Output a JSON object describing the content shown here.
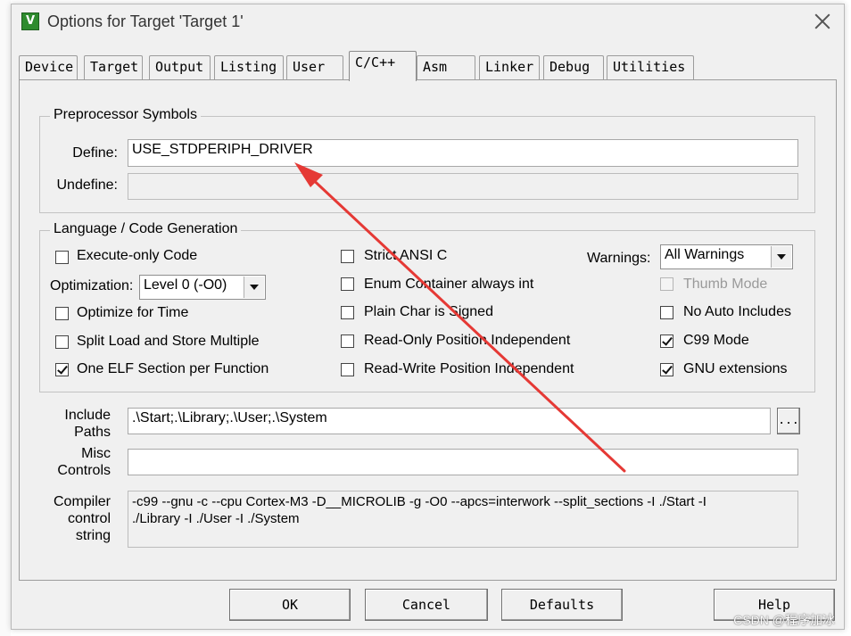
{
  "window": {
    "title": "Options for Target 'Target 1'"
  },
  "tabs": [
    {
      "label": "Device"
    },
    {
      "label": "Target"
    },
    {
      "label": "Output"
    },
    {
      "label": "Listing"
    },
    {
      "label": "User"
    },
    {
      "label": "C/C++"
    },
    {
      "label": "Asm"
    },
    {
      "label": "Linker"
    },
    {
      "label": "Debug"
    },
    {
      "label": "Utilities"
    }
  ],
  "active_tab": "C/C++",
  "preprocessor": {
    "group_label": "Preprocessor Symbols",
    "define_label": "Define:",
    "define_value": "USE_STDPERIPH_DRIVER",
    "undefine_label": "Undefine:",
    "undefine_value": ""
  },
  "language": {
    "group_label": "Language / Code Generation",
    "execute_only": {
      "label": "Execute-only Code",
      "checked": false
    },
    "optimization_label": "Optimization:",
    "optimization_value": "Level 0 (-O0)",
    "optimize_time": {
      "label": "Optimize for Time",
      "checked": false
    },
    "split_load": {
      "label": "Split Load and Store Multiple",
      "checked": false
    },
    "one_elf": {
      "label": "One ELF Section per Function",
      "checked": true
    },
    "strict_ansi": {
      "label": "Strict ANSI C",
      "checked": false
    },
    "enum_container": {
      "label": "Enum Container always int",
      "checked": false
    },
    "plain_char": {
      "label": "Plain Char is Signed",
      "checked": false
    },
    "ro_pi": {
      "label": "Read-Only Position Independent",
      "checked": false
    },
    "rw_pi": {
      "label": "Read-Write Position Independent",
      "checked": false
    },
    "warnings_label": "Warnings:",
    "warnings_value": "All Warnings",
    "thumb_mode": {
      "label": "Thumb Mode",
      "checked": false,
      "disabled": true
    },
    "no_auto_includes": {
      "label": "No Auto Includes",
      "checked": false
    },
    "c99_mode": {
      "label": "C99 Mode",
      "checked": true
    },
    "gnu_extensions": {
      "label": "GNU extensions",
      "checked": true
    }
  },
  "paths": {
    "include_label_1": "Include",
    "include_label_2": "Paths",
    "include_value": ".\\Start;.\\Library;.\\User;.\\System",
    "browse_label": "...",
    "misc_label_1": "Misc",
    "misc_label_2": "Controls",
    "misc_value": "",
    "compiler_label_1": "Compiler",
    "compiler_label_2": "control",
    "compiler_label_3": "string",
    "compiler_line_1": "-c99 --gnu -c --cpu Cortex-M3 -D__MICROLIB -g -O0 --apcs=interwork --split_sections -I ./Start -I",
    "compiler_line_2": "./Library -I ./User -I ./System"
  },
  "buttons": {
    "ok": "OK",
    "cancel": "Cancel",
    "defaults": "Defaults",
    "help": "Help"
  },
  "watermark": "CSDN @程序加冰",
  "colors": {
    "dialog_bg": "#f0f0f0",
    "arrow": "#e53935",
    "app_icon": "#2e8b2e"
  },
  "icons": {
    "app": "keil-uvision-icon",
    "close": "close-icon",
    "arrow": "red-annotation-arrow"
  }
}
